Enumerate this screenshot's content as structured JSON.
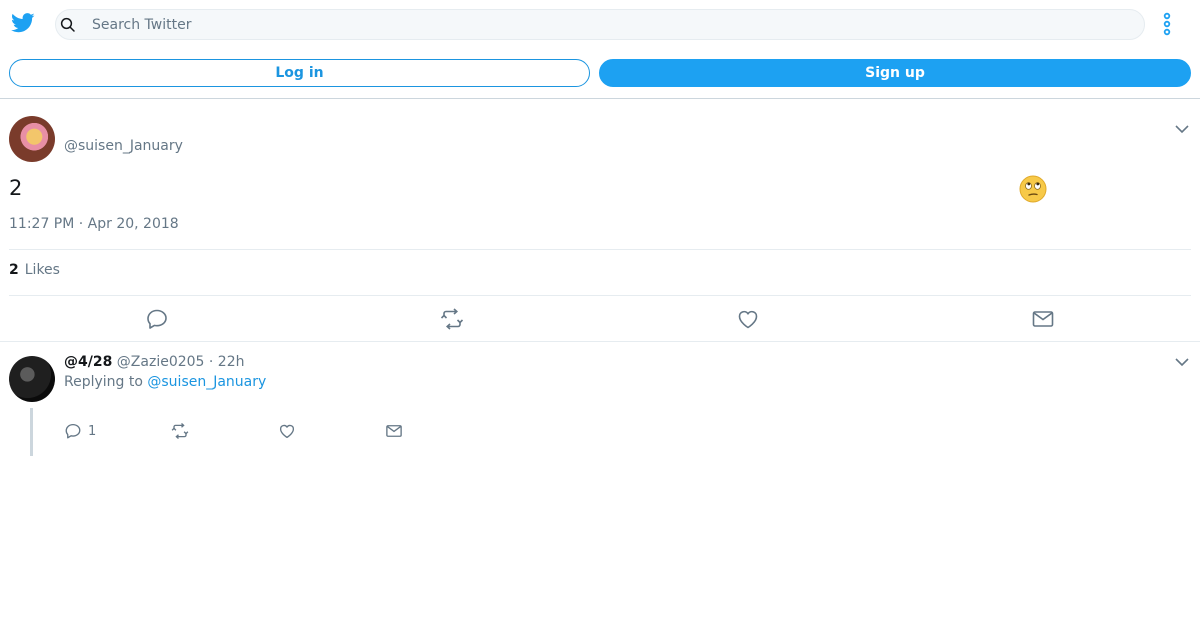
{
  "header": {
    "search_placeholder": "Search Twitter",
    "logo_icon": "twitter-bird-icon",
    "more_icon": "more-vertical-icon"
  },
  "auth": {
    "login_label": "Log in",
    "signup_label": "Sign up"
  },
  "tweet": {
    "username": "@suisen_January",
    "text": "2",
    "timestamp": "11:27 PM · Apr 20, 2018",
    "likes_count": "2",
    "likes_label": "Likes",
    "emoji_icon": "face-with-rolling-eyes-icon"
  },
  "reply": {
    "display_name": "@4/28",
    "handle": "@Zazie0205",
    "time": "· 22h",
    "replying_prefix": "Replying to",
    "replying_to": "@suisen_January",
    "reply_count": "1"
  },
  "colors": {
    "brand_blue": "#1da1f2",
    "link_blue": "#1b95e0",
    "muted_text": "#657786",
    "border": "#e6ecf0"
  }
}
